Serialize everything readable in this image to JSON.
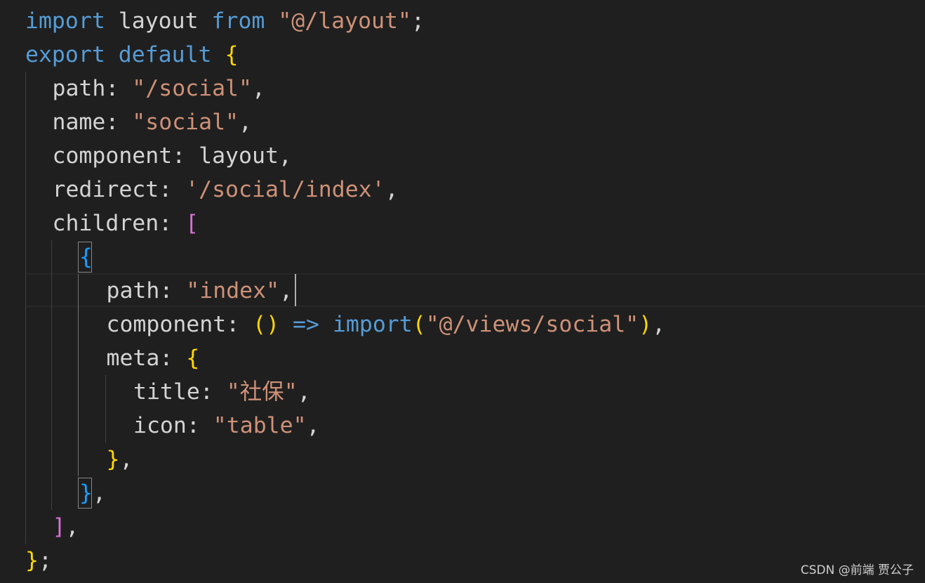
{
  "editor": {
    "language": "javascript",
    "theme_colors": {
      "background": "#1f1f1f",
      "keyword": "#569cd6",
      "string": "#ce9178",
      "text": "#d4d4d4",
      "bracket_level1": "#ffd700",
      "bracket_level2": "#da70d6",
      "bracket_level3": "#179fff"
    },
    "cursor": {
      "line": 9,
      "after": "path: \"index\","
    },
    "lines": [
      {
        "indent": 0,
        "tokens": [
          {
            "t": "import",
            "c": "kw"
          },
          {
            "t": " layout ",
            "c": "prop"
          },
          {
            "t": "from",
            "c": "kw"
          },
          {
            "t": " ",
            "c": "pun"
          },
          {
            "t": "\"@/layout\"",
            "c": "str"
          },
          {
            "t": ";",
            "c": "pun"
          }
        ]
      },
      {
        "indent": 0,
        "tokens": [
          {
            "t": "export",
            "c": "kw"
          },
          {
            "t": " ",
            "c": "pun"
          },
          {
            "t": "default",
            "c": "kw"
          },
          {
            "t": " ",
            "c": "pun"
          },
          {
            "t": "{",
            "c": "br1"
          }
        ]
      },
      {
        "indent": 1,
        "tokens": [
          {
            "t": "path",
            "c": "prop"
          },
          {
            "t": ": ",
            "c": "pun"
          },
          {
            "t": "\"/social\"",
            "c": "str"
          },
          {
            "t": ",",
            "c": "pun"
          }
        ]
      },
      {
        "indent": 1,
        "tokens": [
          {
            "t": "name",
            "c": "prop"
          },
          {
            "t": ": ",
            "c": "pun"
          },
          {
            "t": "\"social\"",
            "c": "str"
          },
          {
            "t": ",",
            "c": "pun"
          }
        ]
      },
      {
        "indent": 1,
        "tokens": [
          {
            "t": "component",
            "c": "prop"
          },
          {
            "t": ": ",
            "c": "pun"
          },
          {
            "t": "layout",
            "c": "prop"
          },
          {
            "t": ",",
            "c": "pun"
          }
        ]
      },
      {
        "indent": 1,
        "tokens": [
          {
            "t": "redirect",
            "c": "prop"
          },
          {
            "t": ": ",
            "c": "pun"
          },
          {
            "t": "'/social/index'",
            "c": "str"
          },
          {
            "t": ",",
            "c": "pun"
          }
        ]
      },
      {
        "indent": 1,
        "tokens": [
          {
            "t": "children",
            "c": "prop"
          },
          {
            "t": ": ",
            "c": "pun"
          },
          {
            "t": "[",
            "c": "br2"
          }
        ]
      },
      {
        "indent": 2,
        "tokens": [
          {
            "t": "{",
            "c": "br3"
          }
        ]
      },
      {
        "indent": 3,
        "tokens": [
          {
            "t": "path",
            "c": "prop"
          },
          {
            "t": ": ",
            "c": "pun"
          },
          {
            "t": "\"index\"",
            "c": "str"
          },
          {
            "t": ",",
            "c": "pun"
          }
        ]
      },
      {
        "indent": 3,
        "tokens": [
          {
            "t": "component",
            "c": "prop"
          },
          {
            "t": ": ",
            "c": "pun"
          },
          {
            "t": "()",
            "c": "br1"
          },
          {
            "t": " ",
            "c": "pun"
          },
          {
            "t": "=>",
            "c": "kw"
          },
          {
            "t": " ",
            "c": "pun"
          },
          {
            "t": "import",
            "c": "kw"
          },
          {
            "t": "(",
            "c": "br1"
          },
          {
            "t": "\"@/views/social\"",
            "c": "str"
          },
          {
            "t": ")",
            "c": "br1"
          },
          {
            "t": ",",
            "c": "pun"
          }
        ]
      },
      {
        "indent": 3,
        "tokens": [
          {
            "t": "meta",
            "c": "prop"
          },
          {
            "t": ": ",
            "c": "pun"
          },
          {
            "t": "{",
            "c": "br1"
          }
        ]
      },
      {
        "indent": 4,
        "tokens": [
          {
            "t": "title",
            "c": "prop"
          },
          {
            "t": ": ",
            "c": "pun"
          },
          {
            "t": "\"社保\"",
            "c": "str"
          },
          {
            "t": ",",
            "c": "pun"
          }
        ]
      },
      {
        "indent": 4,
        "tokens": [
          {
            "t": "icon",
            "c": "prop"
          },
          {
            "t": ": ",
            "c": "pun"
          },
          {
            "t": "\"table\"",
            "c": "str"
          },
          {
            "t": ",",
            "c": "pun"
          }
        ]
      },
      {
        "indent": 3,
        "tokens": [
          {
            "t": "}",
            "c": "br1"
          },
          {
            "t": ",",
            "c": "pun"
          }
        ]
      },
      {
        "indent": 2,
        "tokens": [
          {
            "t": "}",
            "c": "br3"
          },
          {
            "t": ",",
            "c": "pun"
          }
        ]
      },
      {
        "indent": 1,
        "tokens": [
          {
            "t": "]",
            "c": "br2"
          },
          {
            "t": ",",
            "c": "pun"
          }
        ]
      },
      {
        "indent": 0,
        "tokens": [
          {
            "t": "}",
            "c": "br1"
          },
          {
            "t": ";",
            "c": "pun"
          }
        ]
      }
    ]
  },
  "watermark": {
    "text": "CSDN @前端 贾公子"
  }
}
